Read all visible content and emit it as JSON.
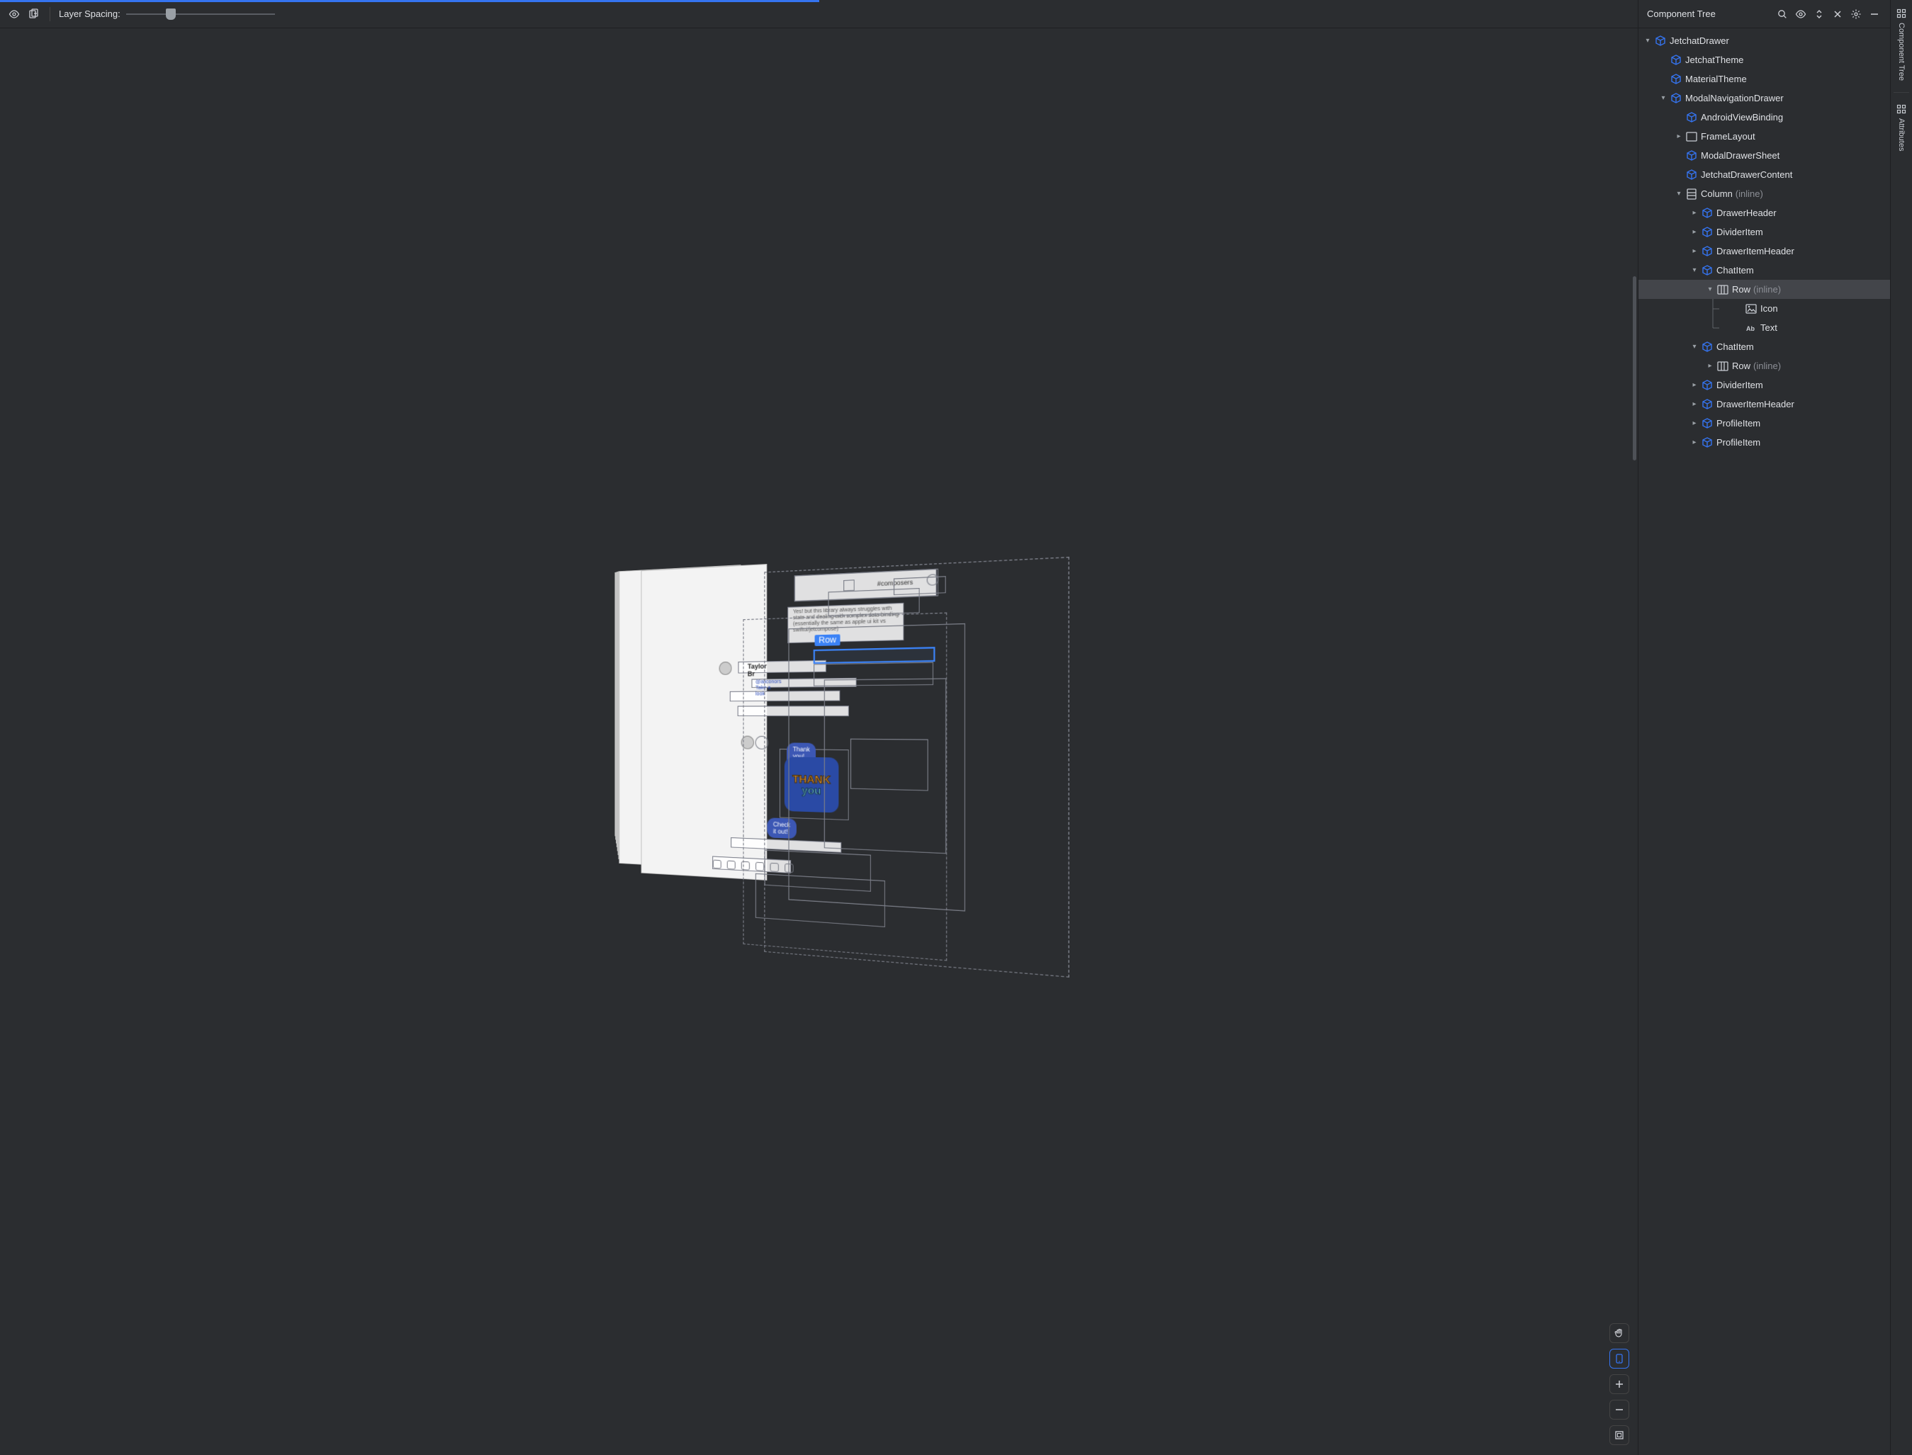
{
  "toolbar": {
    "layer_spacing_label": "Layer Spacing:"
  },
  "selection": {
    "label": "Row"
  },
  "side_panel": {
    "title": "Component Tree"
  },
  "rail": {
    "tab1": "Component Tree",
    "tab2": "Attributes"
  },
  "preview": {
    "channel_hash": "#composers",
    "author1": "Taylor Br",
    "mention_line": "@aliconors Take a look",
    "thankyou_small": "Thank you!",
    "thank_top": "THANK",
    "thank_bottom": "you",
    "checkit": "Check it out!",
    "paragraph": "Yes! but this library always struggles with state and dealing with complex data binding (essentially the same as apple ui kit vs swiftui/jetcompose)"
  },
  "tree": [
    {
      "depth": 0,
      "chev": "down",
      "icon": "compose",
      "label": "JetchatDrawer",
      "selected": false
    },
    {
      "depth": 1,
      "chev": "none",
      "icon": "compose",
      "label": "JetchatTheme",
      "selected": false
    },
    {
      "depth": 1,
      "chev": "none",
      "icon": "compose",
      "label": "MaterialTheme",
      "selected": false
    },
    {
      "depth": 1,
      "chev": "down",
      "icon": "compose",
      "label": "ModalNavigationDrawer",
      "selected": false
    },
    {
      "depth": 2,
      "chev": "none",
      "icon": "compose",
      "label": "AndroidViewBinding",
      "selected": false
    },
    {
      "depth": 2,
      "chev": "right",
      "icon": "rect",
      "label": "FrameLayout",
      "selected": false
    },
    {
      "depth": 2,
      "chev": "none",
      "icon": "compose",
      "label": "ModalDrawerSheet",
      "selected": false
    },
    {
      "depth": 2,
      "chev": "none",
      "icon": "compose",
      "label": "JetchatDrawerContent",
      "selected": false
    },
    {
      "depth": 2,
      "chev": "down",
      "icon": "col",
      "label": "Column",
      "suffix": "(inline)",
      "selected": false
    },
    {
      "depth": 3,
      "chev": "right",
      "icon": "compose",
      "label": "DrawerHeader",
      "selected": false
    },
    {
      "depth": 3,
      "chev": "right",
      "icon": "compose",
      "label": "DividerItem",
      "selected": false
    },
    {
      "depth": 3,
      "chev": "right",
      "icon": "compose",
      "label": "DrawerItemHeader",
      "selected": false
    },
    {
      "depth": 3,
      "chev": "down",
      "icon": "compose",
      "label": "ChatItem",
      "selected": false
    },
    {
      "depth": 4,
      "chev": "down",
      "icon": "row",
      "label": "Row",
      "suffix": "(inline)",
      "selected": true
    },
    {
      "depth": 5,
      "chev": "none",
      "icon": "img",
      "label": "Icon",
      "selected": false,
      "guide": true
    },
    {
      "depth": 5,
      "chev": "none",
      "icon": "ab",
      "label": "Text",
      "selected": false,
      "guide": true,
      "guideend": true
    },
    {
      "depth": 3,
      "chev": "down",
      "icon": "compose",
      "label": "ChatItem",
      "selected": false
    },
    {
      "depth": 4,
      "chev": "right",
      "icon": "row",
      "label": "Row",
      "suffix": "(inline)",
      "selected": false
    },
    {
      "depth": 3,
      "chev": "right",
      "icon": "compose",
      "label": "DividerItem",
      "selected": false
    },
    {
      "depth": 3,
      "chev": "right",
      "icon": "compose",
      "label": "DrawerItemHeader",
      "selected": false
    },
    {
      "depth": 3,
      "chev": "right",
      "icon": "compose",
      "label": "ProfileItem",
      "selected": false
    },
    {
      "depth": 3,
      "chev": "right",
      "icon": "compose",
      "label": "ProfileItem",
      "selected": false
    }
  ]
}
